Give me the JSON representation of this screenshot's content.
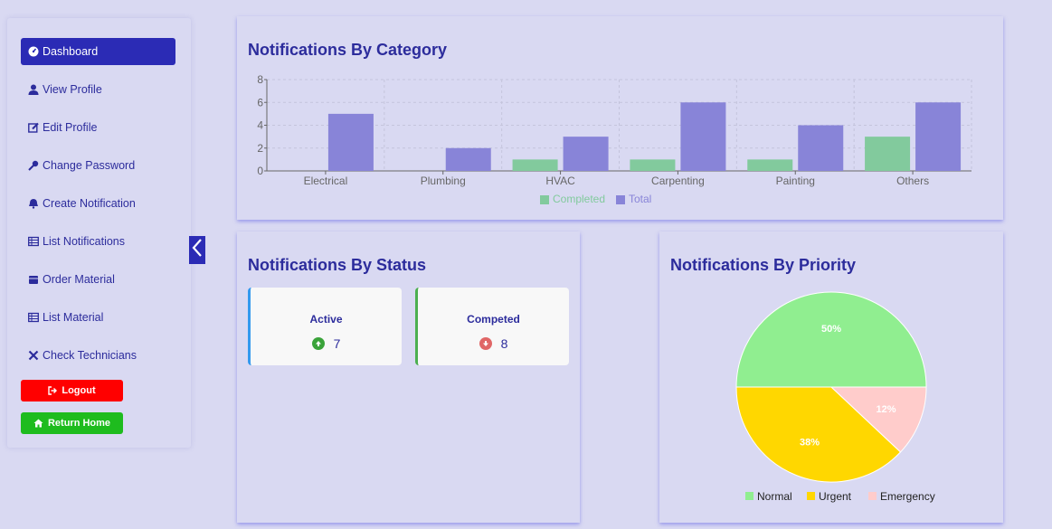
{
  "sidebar": {
    "items": [
      {
        "label": "Dashboard",
        "icon": "dashboard-icon"
      },
      {
        "label": "View Profile",
        "icon": "user-icon"
      },
      {
        "label": "Edit Profile",
        "icon": "edit-icon"
      },
      {
        "label": "Change Password",
        "icon": "key-icon"
      },
      {
        "label": "Create Notification",
        "icon": "bell-icon"
      },
      {
        "label": "List Notifications",
        "icon": "list-icon"
      },
      {
        "label": "Order Material",
        "icon": "box-icon"
      },
      {
        "label": "List Material",
        "icon": "list-icon"
      },
      {
        "label": "Check Technicians",
        "icon": "tools-icon"
      }
    ],
    "logout_label": "Logout",
    "home_label": "Return Home"
  },
  "category_card": {
    "title": "Notifications By Category"
  },
  "status_card": {
    "title": "Notifications By Status",
    "active_label": "Active",
    "active_value": "7",
    "completed_label": "Competed",
    "completed_value": "8"
  },
  "priority_card": {
    "title": "Notifications By Priority"
  },
  "colors": {
    "accent": "#2b2bb5",
    "completed": "#82ca9d",
    "total": "#8884d8",
    "normal": "#90ee90",
    "urgent": "#ffd700",
    "emergency": "#ffcccb",
    "logout": "#ff0000",
    "home": "#1ebc1e"
  },
  "chart_data": [
    {
      "type": "bar",
      "categories": [
        "Electrical",
        "Plumbing",
        "HVAC",
        "Carpenting",
        "Painting",
        "Others"
      ],
      "series": [
        {
          "name": "Completed",
          "values": [
            0,
            0,
            1,
            1,
            1,
            3
          ]
        },
        {
          "name": "Total",
          "values": [
            5,
            2,
            3,
            6,
            4,
            6
          ]
        }
      ],
      "ylim": [
        0,
        8
      ],
      "yticks": [
        "0",
        "2",
        "4",
        "6",
        "8"
      ],
      "grid": true,
      "legend": "bottom"
    },
    {
      "type": "pie",
      "labels": [
        "Normal",
        "Urgent",
        "Emergency"
      ],
      "values": [
        50,
        38,
        12
      ],
      "value_labels": [
        "50%",
        "38%",
        "12%"
      ],
      "legend": "bottom"
    }
  ]
}
